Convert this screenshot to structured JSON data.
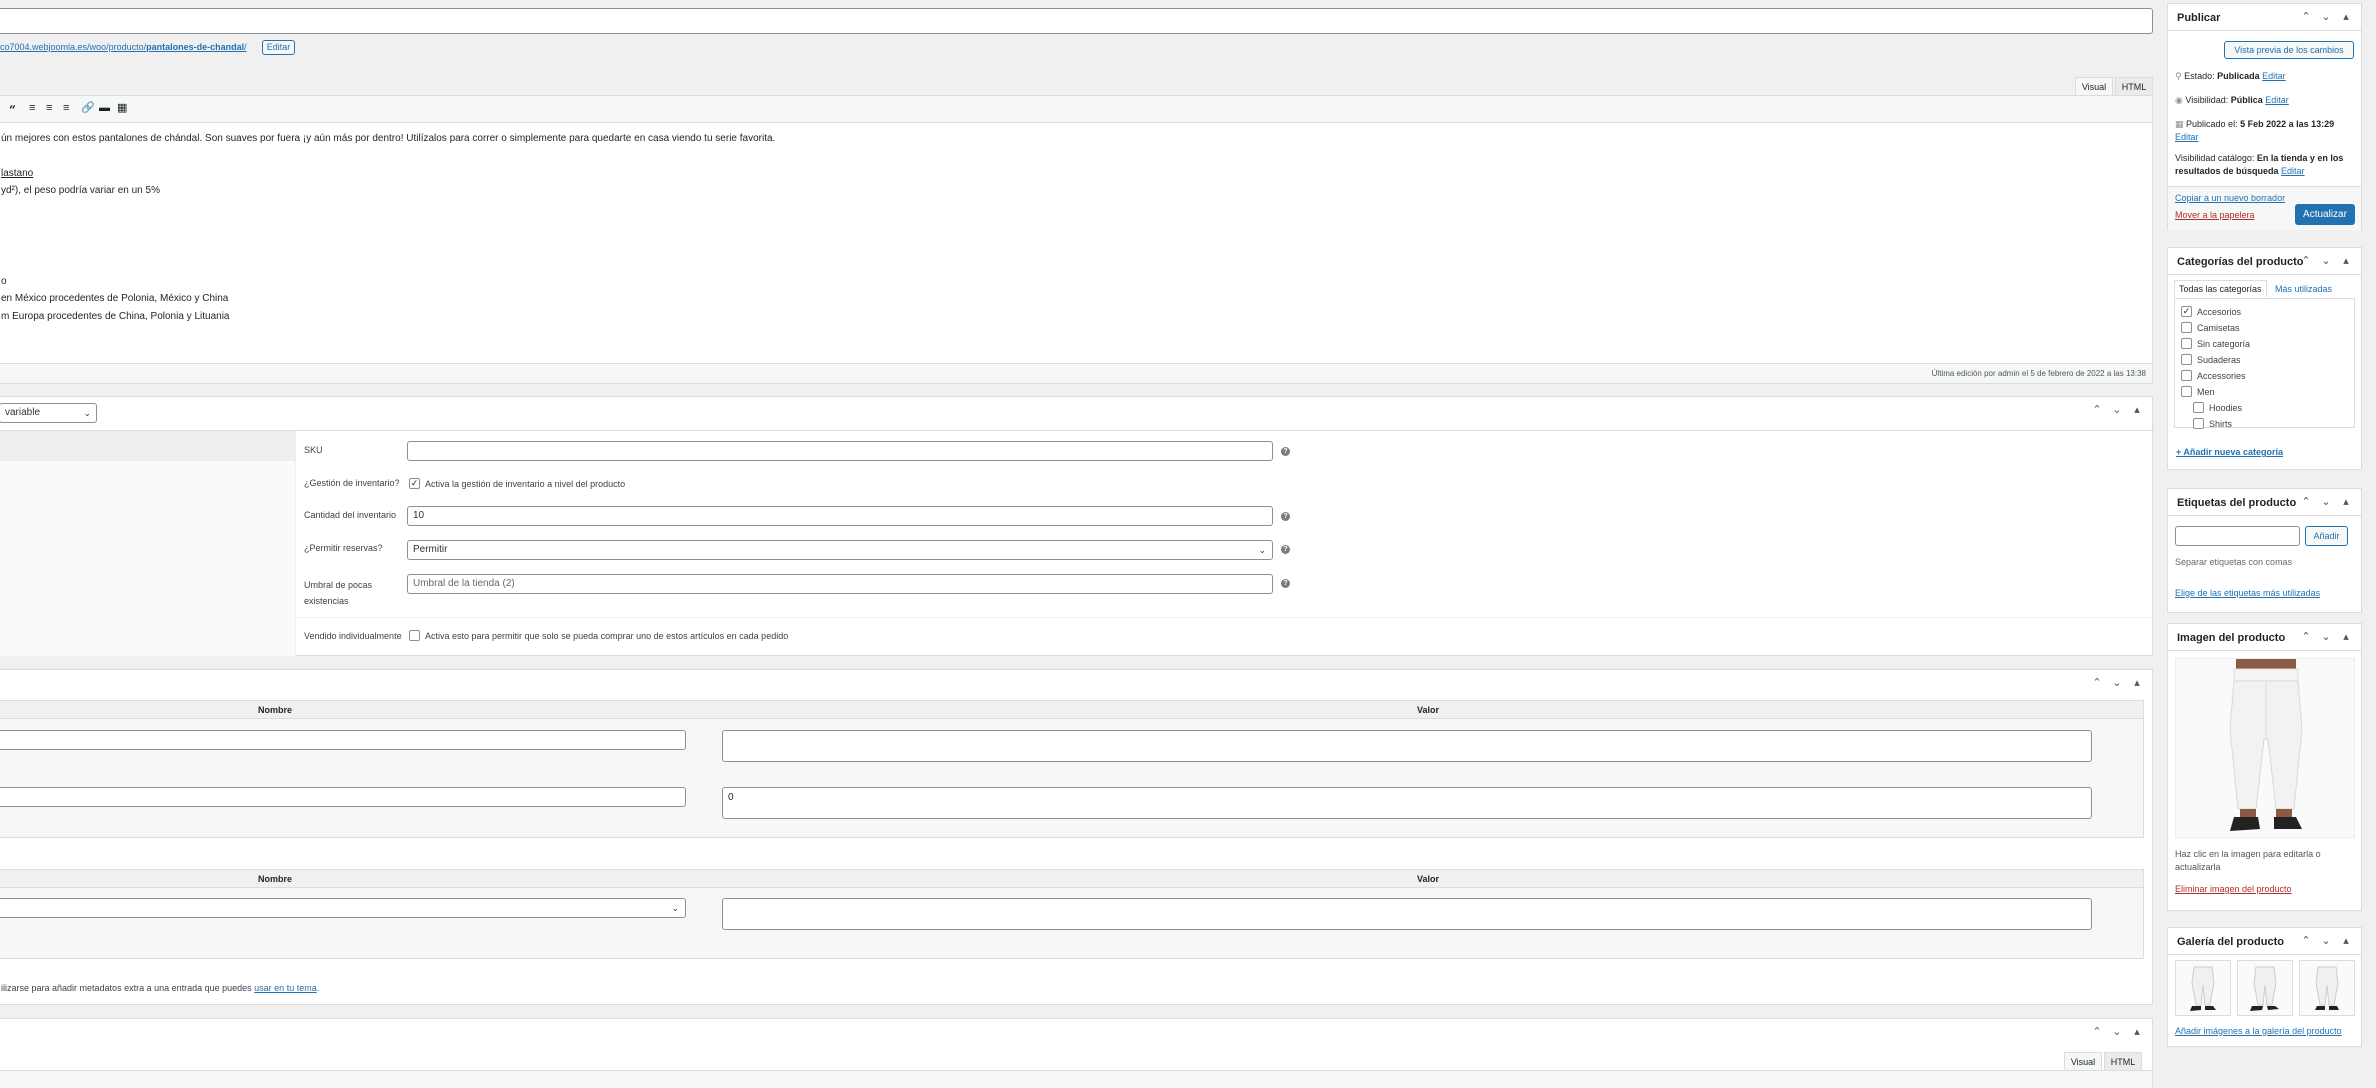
{
  "permalink": {
    "url_prefix": "co7004.webjoomla.es/woo/producto/",
    "slug": "pantalones-de-chandal",
    "suffix": "/",
    "edit_label": "Editar"
  },
  "editor": {
    "tab_visual": "Visual",
    "tab_html": "HTML",
    "toolbar_quote_icon": "66",
    "lines": [
      "ún mejores con estos pantalones de chándal. Son suaves por fuera ¡y aún más por dentro! Utilízalos para correr o simplemente para quedarte en casa viendo tu serie favorita.",
      "lastano",
      "yd²), el peso podría variar en un 5%",
      "o",
      "en México procedentes de Polonia, México y China",
      "m Europa procedentes de China, Polonia y Lituania"
    ],
    "last_edit": "Última edición por admin el 5 de febrero de 2022 a las 13:38"
  },
  "product_data": {
    "type_select": "variable",
    "sku_label": "SKU",
    "sku_value": "",
    "manage_stock_label": "¿Gestión de inventario?",
    "manage_stock_desc": "Activa la gestión de inventario a nivel del producto",
    "stock_qty_label": "Cantidad del inventario",
    "stock_qty_value": "10",
    "backorders_label": "¿Permitir reservas?",
    "backorders_value": "Permitir",
    "low_stock_label_1": "Umbral de pocas",
    "low_stock_label_2": "existencias",
    "low_stock_placeholder": "Umbral de la tienda (2)",
    "sold_individually_label": "Vendido individualmente",
    "sold_individually_desc": "Activa esto para permitir que solo se pueda comprar uno de estos artículos en cada pedido"
  },
  "custom_fields": {
    "col_name": "Nombre",
    "col_value": "Valor",
    "row1_name": "",
    "row1_value": "",
    "row2_name": "",
    "row2_value": "0",
    "add_col_name": "Nombre",
    "add_col_value": "Valor",
    "footer_text": "ilizarse para añadir metadatos extra a una entrada que puedes ",
    "footer_link": "usar en tu tema",
    "footer_end": "."
  },
  "bottom_editor": {
    "tab_visual": "Visual",
    "tab_html": "HTML"
  },
  "publish": {
    "title": "Publicar",
    "preview_button": "Vista previa de los cambios",
    "status_label": "Estado: ",
    "status_value": "Publicada",
    "visibility_label": "Visibilidad: ",
    "visibility_value": "Pública",
    "published_label": "Publicado el: ",
    "published_value": "5 Feb 2022 a las 13:29",
    "catalog_label": "Visibilidad catálogo: ",
    "catalog_value": "En la tienda y en los resultados de búsqueda",
    "edit_label": "Editar",
    "copy_draft": "Copiar a un nuevo borrador",
    "trash": "Mover a la papelera",
    "update_button": "Actualizar"
  },
  "categories": {
    "title": "Categorías del producto",
    "tab_all": "Todas las categorías",
    "tab_used": "Más utilizadas",
    "items": [
      {
        "label": "Accesorios",
        "checked": true
      },
      {
        "label": "Camisetas",
        "checked": false
      },
      {
        "label": "Sin categoría",
        "checked": false
      },
      {
        "label": "Sudaderas",
        "checked": false
      },
      {
        "label": "Accessories",
        "checked": false
      },
      {
        "label": "Men",
        "checked": false
      },
      {
        "label": "Hoodies",
        "checked": false
      },
      {
        "label": "Shirts",
        "checked": false
      }
    ],
    "add_new": "+ Añadir nueva categoría"
  },
  "tags": {
    "title": "Etiquetas del producto",
    "add_button": "Añadir",
    "hint": "Separar etiquetas con comas",
    "choose_link": "Elige de las etiquetas más utilizadas"
  },
  "image": {
    "title": "Imagen del producto",
    "hint": "Haz clic en la imagen para editarla o actualizarla",
    "remove": "Eliminar imagen del producto"
  },
  "gallery": {
    "title": "Galería del producto",
    "add_link": "Añadir imágenes a la galería del producto"
  },
  "colors": {
    "accent": "#2271b1",
    "danger": "#b32d2e",
    "border": "#dcdcde",
    "bg": "#f0f0f1"
  }
}
